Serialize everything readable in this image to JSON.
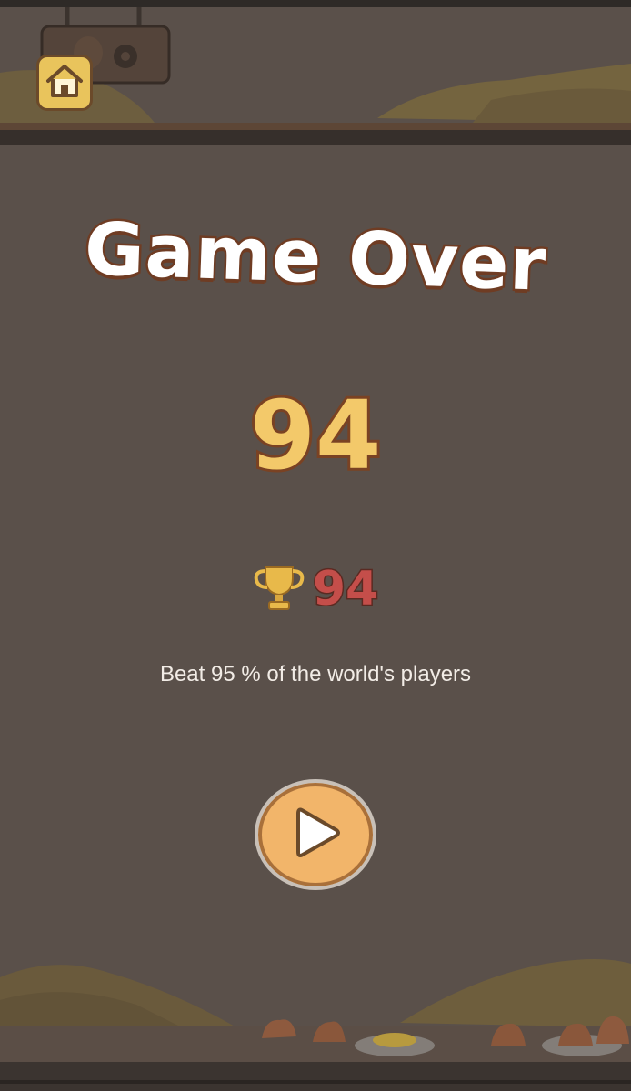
{
  "game": {
    "title": "Game Over",
    "score": "94",
    "best_score": "94",
    "beat_message": "Beat 95 % of the world's players"
  },
  "icons": {
    "home": "home-icon",
    "trophy": "trophy-icon",
    "play": "play-icon"
  },
  "colors": {
    "overlay_background": "#5a504a",
    "title_fill": "#ffffff",
    "title_outline": "#6f3c23",
    "score_fill": "#f3c96a",
    "best_score_fill": "#c44e4a",
    "button_fill": "#f2b56a"
  }
}
